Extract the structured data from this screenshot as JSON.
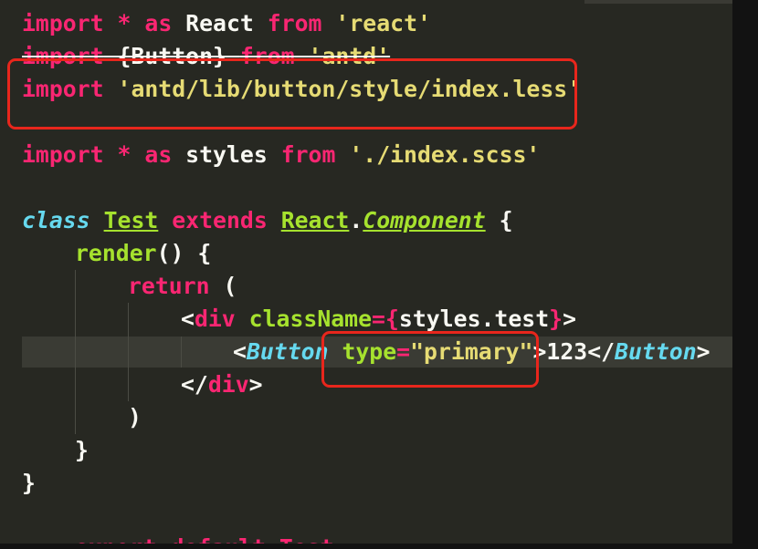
{
  "editor": {
    "lines": [
      {
        "id": "l1",
        "tokens": {
          "a": "import",
          "b": " ",
          "c": "*",
          "d": " ",
          "e": "as",
          "f": " React ",
          "g": "from",
          "h": " ",
          "i": "'react'"
        }
      },
      {
        "id": "l2",
        "tokens": {
          "a": "import",
          "b": " {Button} ",
          "c": "from",
          "d": " ",
          "e": "'antd'"
        }
      },
      {
        "id": "l3",
        "tokens": {
          "a": "import",
          "b": " ",
          "c": "'antd/lib/button/style/index.less'"
        }
      },
      {
        "id": "l4",
        "tokens": {
          "a": "import",
          "b": " ",
          "c": "*",
          "d": " ",
          "e": "as",
          "f": " styles ",
          "g": "from",
          "h": " ",
          "i": "'./index.scss'"
        }
      },
      {
        "id": "l5",
        "tokens": {
          "a": "class",
          "b": " ",
          "c": "Test",
          "d": " ",
          "e": "extends",
          "f": " ",
          "g": "React",
          "h": ".",
          "i": "Component",
          "j": " {"
        }
      },
      {
        "id": "l6",
        "tokens": {
          "a": "render",
          "b": "() {"
        }
      },
      {
        "id": "l7",
        "tokens": {
          "a": "return",
          "b": " ("
        }
      },
      {
        "id": "l8",
        "tokens": {
          "a": "<",
          "b": "div",
          "c": " ",
          "d": "className",
          "e": "=",
          "f": "{",
          "g": "styles.test",
          "h": "}",
          "i": ">"
        }
      },
      {
        "id": "l9",
        "tokens": {
          "a": "<",
          "b": "Button",
          "c": " ",
          "d": "type",
          "e": "=",
          "f": "\"primary\"",
          "g": ">",
          "h": "123",
          "i": "</",
          "j": "Button",
          "k": ">"
        }
      },
      {
        "id": "l10",
        "tokens": {
          "a": "</",
          "b": "div",
          "c": ">"
        }
      },
      {
        "id": "l11",
        "tokens": {
          "a": ")"
        }
      },
      {
        "id": "l12",
        "tokens": {
          "a": "}"
        }
      },
      {
        "id": "l13",
        "tokens": {
          "a": "}"
        }
      },
      {
        "id": "l14",
        "tokens": {
          "a": "export default Test"
        }
      }
    ]
  },
  "colors": {
    "background": "#272822",
    "keyword": "#f92672",
    "string": "#e6db74",
    "function": "#a6e22e",
    "storage": "#66d9ef",
    "default": "#f8f8f2",
    "annotation_box": "#e8261c"
  }
}
